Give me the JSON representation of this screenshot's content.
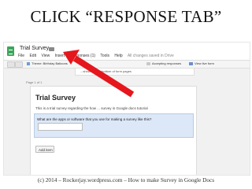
{
  "slide": {
    "title": "CLICK “RESPONSE TAB”",
    "caption": "(c) 2014 – Rockerjay.wordpress.com – How to make Survey in Google Docs"
  },
  "app": {
    "doc_title": "Trial Survey",
    "menu": [
      "File",
      "Edit",
      "View",
      "Insert",
      "Responses (1)",
      "Tools",
      "Help"
    ],
    "save_status": "All changes saved in Drive"
  },
  "toolbar": {
    "theme_label": "Theme: Birthday Balloons",
    "accepting_label": "Accepting responses",
    "view_live_label": "View live form"
  },
  "notice": {
    "text": "...shown at the bottom of form pages"
  },
  "form": {
    "page_label": "Page 1 of 1",
    "title": "Trial Survey",
    "description": "This is a trial survey regarding the how ... survey in Google docs tutorial",
    "question": "What are the apps or software that you use for making a survey like this?",
    "add_item_label": "Add item"
  },
  "annotation": {
    "arrow_color": "#e5161c",
    "arrow_target": "Responses tab"
  }
}
